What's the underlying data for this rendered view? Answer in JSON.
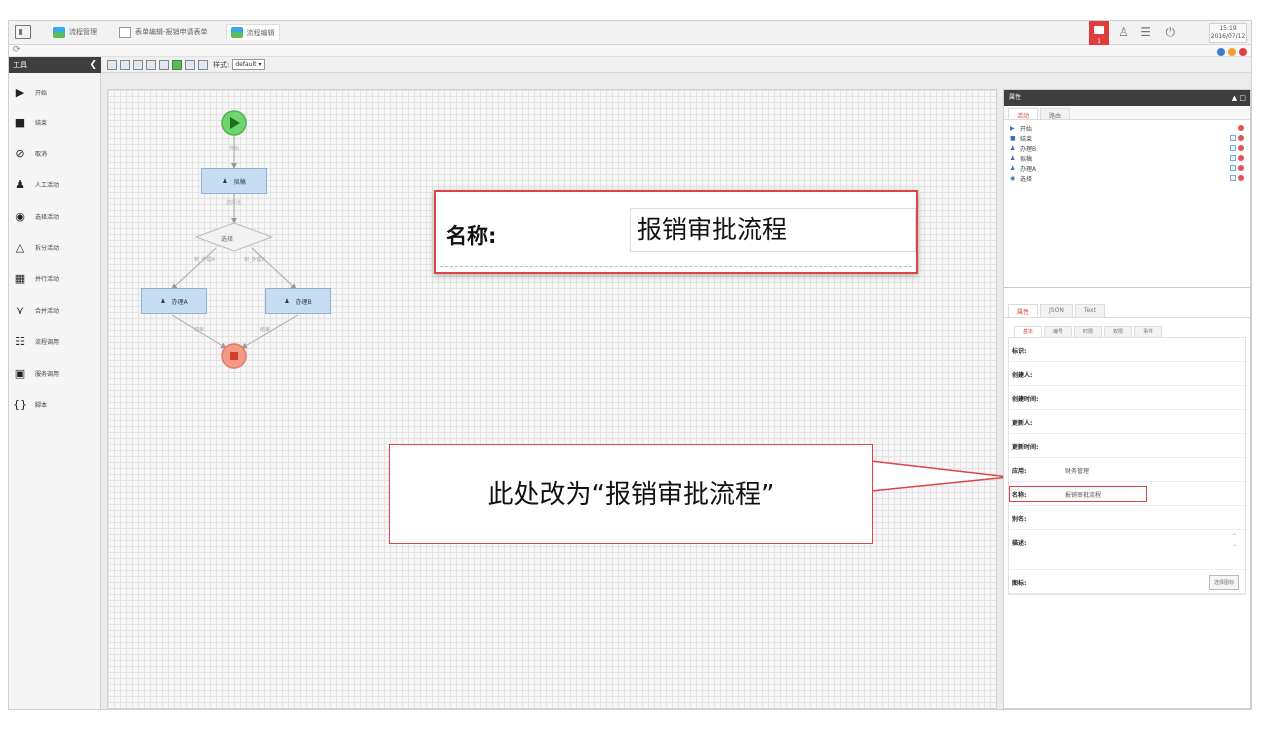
{
  "tabs": [
    {
      "label": "流程管理",
      "icon": "flow-icon"
    },
    {
      "label": "表单编辑-报销申请表单",
      "icon": "document-icon"
    },
    {
      "label": "流程编辑",
      "icon": "flow-icon"
    }
  ],
  "header": {
    "notification_count": "1",
    "time": "15:19",
    "date": "2016/07/12"
  },
  "toolbar": {
    "style_label": "样式:",
    "style_value": "default"
  },
  "tools": {
    "title": "工具",
    "items": [
      {
        "label": "开始"
      },
      {
        "label": "结束"
      },
      {
        "label": "取消"
      },
      {
        "label": "人工活动"
      },
      {
        "label": "选择活动"
      },
      {
        "label": "拆分活动"
      },
      {
        "label": "并行活动"
      },
      {
        "label": "合并活动"
      },
      {
        "label": "流程调用"
      },
      {
        "label": "服务调用"
      },
      {
        "label": "脚本"
      }
    ]
  },
  "diagram": {
    "start_edge": "开始",
    "task_draft": "拟稿",
    "choice": "选择",
    "choice_in_edge": "选择活",
    "edge_a": "到_办理A",
    "edge_b": "到_办理B",
    "task_a": "办理A",
    "task_b": "办理B",
    "end_edge_a": "结束",
    "end_edge_b": "结束"
  },
  "zoom": {
    "label": "名称:",
    "value": "报销审批流程"
  },
  "note": {
    "text": "此处改为“报销审批流程”"
  },
  "panel": {
    "title": "属性",
    "list_tabs": [
      "活动",
      "路由"
    ],
    "activities": [
      {
        "name": "开始"
      },
      {
        "name": "结束"
      },
      {
        "name": "办理B"
      },
      {
        "name": "拟稿"
      },
      {
        "name": "办理A"
      },
      {
        "name": "选择"
      }
    ],
    "prop_tabs": [
      "属性",
      "JSON",
      "Text"
    ],
    "sub_tabs": [
      "基本",
      "编号",
      "时限",
      "权限",
      "事件"
    ],
    "fields": {
      "id": "标识:",
      "creator": "创建人:",
      "created_at": "创建时间:",
      "updater": "更新人:",
      "updated_at": "更新时间:",
      "app": "应用:",
      "app_value": "财务管理",
      "name": "名称:",
      "name_value": "报销审批流程",
      "alias": "别名:",
      "desc": "描述:",
      "icon": "图标:",
      "icon_button": "选择图标"
    }
  },
  "colors": {
    "accent": "#dd4444",
    "task_fill": "#c6dcf2",
    "start": "#6fd66f",
    "end": "#f39a86"
  }
}
